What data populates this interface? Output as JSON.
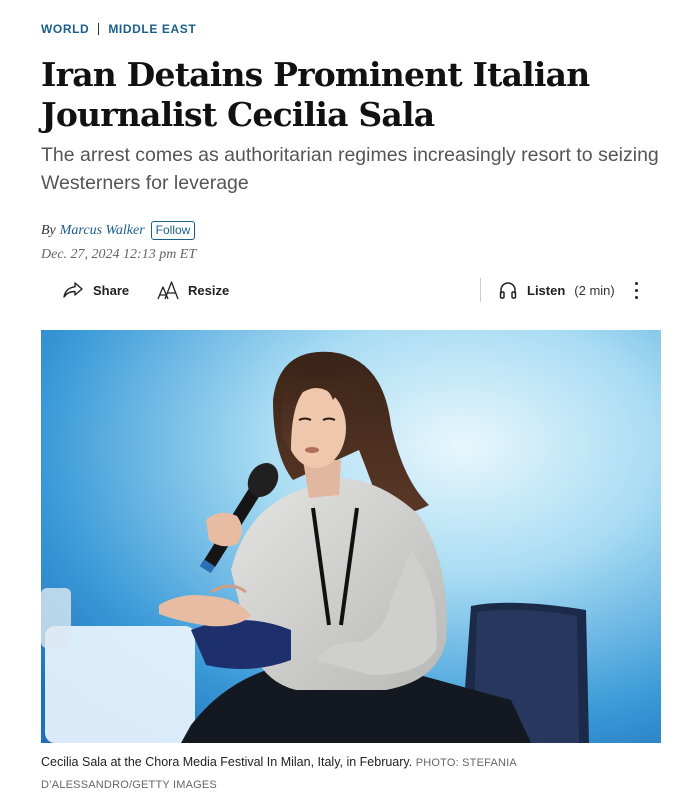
{
  "section": {
    "primary": "WORLD",
    "secondary": "MIDDLE EAST"
  },
  "headline": "Iran Detains Prominent Italian Journalist Cecilia Sala",
  "dek": "The arrest comes as authoritarian regimes increasingly resort to seizing Westerners for leverage",
  "byline": {
    "prefix": "By",
    "author": "Marcus Walker",
    "follow_label": "Follow"
  },
  "date": "Dec. 27, 2024 12:13 pm ET",
  "toolbar": {
    "share_label": "Share",
    "resize_label": "Resize",
    "listen_label": "Listen",
    "listen_duration": "(2 min)",
    "icons": [
      "share-icon",
      "resize-icon",
      "headphones-icon",
      "more-icon"
    ]
  },
  "photo": {
    "caption": "Cecilia Sala at the Chora Media Festival In Milan, Italy, in February.",
    "credit": "PHOTO: STEFANIA D’ALESSANDRO/GETTY IMAGES"
  },
  "colors": {
    "accent": "#1a5f8a",
    "photo_bg_light": "#bfe6f7",
    "photo_bg_dark": "#2b8cd2"
  }
}
